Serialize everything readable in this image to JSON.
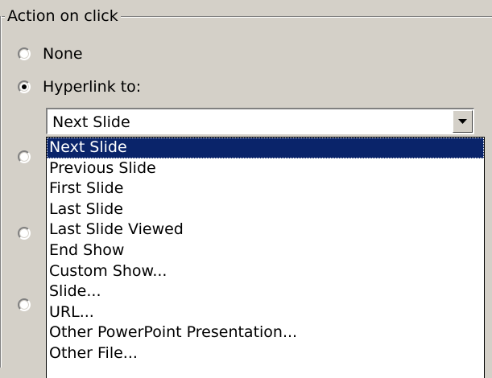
{
  "groupbox": {
    "title": "Action on click"
  },
  "options": [
    {
      "label": "None",
      "checked": false
    },
    {
      "label": "Hyperlink to:",
      "checked": true
    },
    {
      "label": "",
      "checked": false
    },
    {
      "label": "",
      "checked": false
    },
    {
      "label": "",
      "checked": false
    }
  ],
  "combobox": {
    "value": "Next Slide",
    "arrow_icon": "dropdown-arrow-icon"
  },
  "dropdown": {
    "items": [
      {
        "label": "Next Slide",
        "selected": true
      },
      {
        "label": "Previous Slide",
        "selected": false
      },
      {
        "label": "First Slide",
        "selected": false
      },
      {
        "label": "Last Slide",
        "selected": false
      },
      {
        "label": "Last Slide Viewed",
        "selected": false
      },
      {
        "label": "End Show",
        "selected": false
      },
      {
        "label": "Custom Show...",
        "selected": false
      },
      {
        "label": "Slide...",
        "selected": false
      },
      {
        "label": "URL...",
        "selected": false
      },
      {
        "label": "Other PowerPoint Presentation...",
        "selected": false
      },
      {
        "label": "Other File...",
        "selected": false
      }
    ]
  },
  "colors": {
    "window_bg": "#d4d0c8",
    "selection_bg": "#0a246a",
    "selection_fg": "#ffffff"
  }
}
